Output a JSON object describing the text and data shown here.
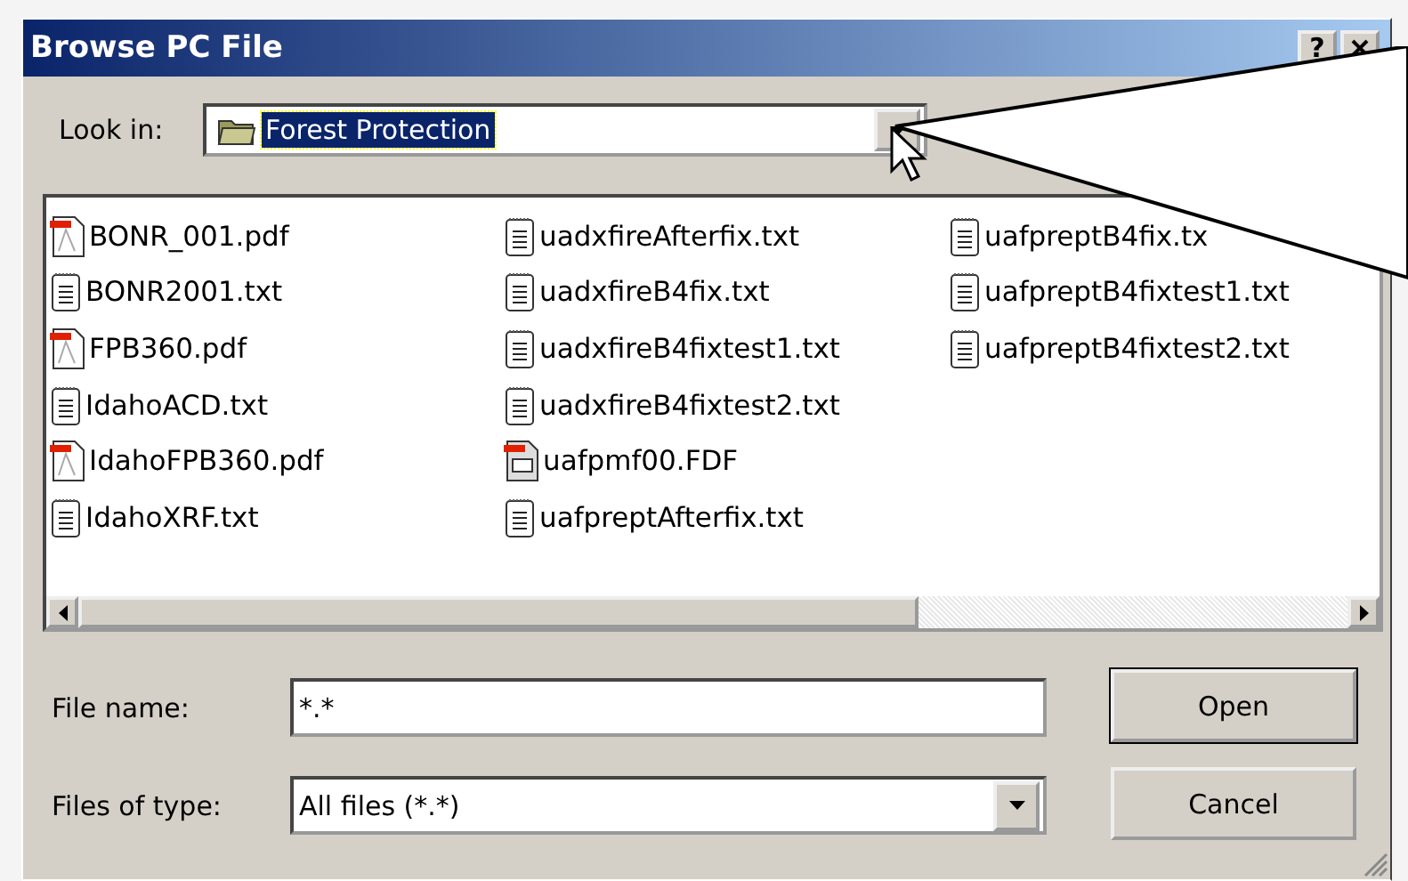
{
  "window": {
    "title": "Browse PC File",
    "help_button": "?"
  },
  "look_in": {
    "label": "Look in:",
    "value": "Forest Protection",
    "highlighted": true
  },
  "files": [
    {
      "name": "BONR_001.pdf",
      "kind": "pdf"
    },
    {
      "name": "BONR2001.txt",
      "kind": "txt"
    },
    {
      "name": "FPB360.pdf",
      "kind": "pdf"
    },
    {
      "name": "IdahoACD.txt",
      "kind": "txt"
    },
    {
      "name": "IdahoFPB360.pdf",
      "kind": "pdf"
    },
    {
      "name": "IdahoXRF.txt",
      "kind": "txt"
    },
    {
      "name": "uadxfireAfterfix.txt",
      "kind": "txt"
    },
    {
      "name": "uadxfireB4fix.txt",
      "kind": "txt"
    },
    {
      "name": "uadxfireB4fixtest1.txt",
      "kind": "txt"
    },
    {
      "name": "uadxfireB4fixtest2.txt",
      "kind": "txt"
    },
    {
      "name": "uafpmf00.FDF",
      "kind": "fdf"
    },
    {
      "name": "uafpreptAfterfix.txt",
      "kind": "txt"
    },
    {
      "name": "uafpreptB4fix.tx",
      "kind": "txt"
    },
    {
      "name": "uafpreptB4fixtest1.txt",
      "kind": "txt"
    },
    {
      "name": "uafpreptB4fixtest2.txt",
      "kind": "txt"
    }
  ],
  "file_name": {
    "label": "File name:",
    "value": "*.*"
  },
  "file_type": {
    "label": "Files of type:",
    "value": "All files (*.*)"
  },
  "buttons": [
    {
      "label": "Open",
      "default": true
    },
    {
      "label": "Cancel",
      "default": false
    }
  ]
}
